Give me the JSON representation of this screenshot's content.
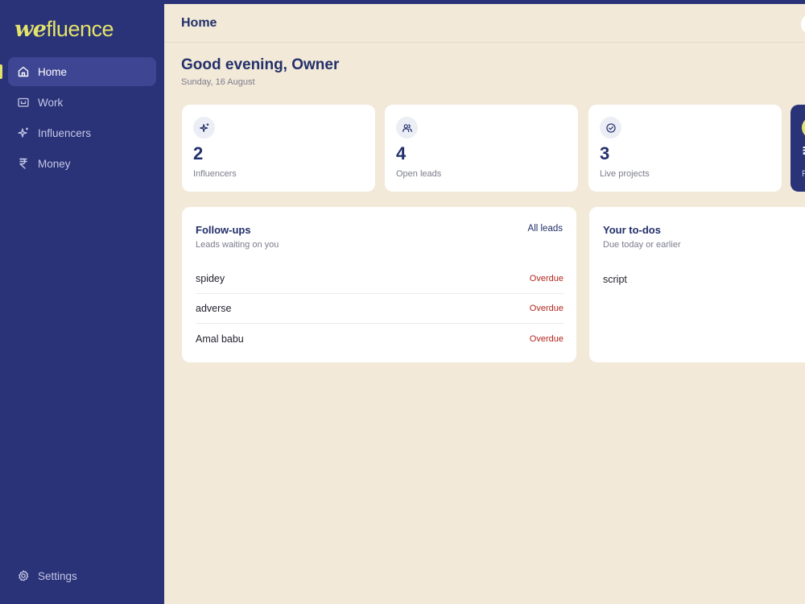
{
  "app": {
    "logo_we": "we",
    "logo_rest": "fluence"
  },
  "sidebar": {
    "items": [
      {
        "label": "Home",
        "icon": "home-icon"
      },
      {
        "label": "Work",
        "icon": "folder-icon"
      },
      {
        "label": "Influencers",
        "icon": "sparkles-icon"
      },
      {
        "label": "Money",
        "icon": "rupee-icon"
      }
    ],
    "settings_label": "Settings"
  },
  "header": {
    "title": "Home"
  },
  "greeting": {
    "title": "Good evening, Owner",
    "date": "Sunday, 16 August"
  },
  "stats": [
    {
      "value": "2",
      "label": "Influencers",
      "icon": "sparkles-icon"
    },
    {
      "value": "4",
      "label": "Open leads",
      "icon": "users-icon"
    },
    {
      "value": "3",
      "label": "Live projects",
      "icon": "check-circle-icon"
    },
    {
      "value": "₹",
      "label": "P",
      "icon": "coin-icon"
    }
  ],
  "followups": {
    "title": "Follow-ups",
    "subtitle": "Leads waiting on you",
    "link": "All leads",
    "rows": [
      {
        "name": "spidey",
        "status": "Overdue"
      },
      {
        "name": "adverse",
        "status": "Overdue"
      },
      {
        "name": "Amal babu",
        "status": "Overdue"
      }
    ]
  },
  "todos": {
    "title": "Your to-dos",
    "subtitle": "Due today or earlier",
    "rows": [
      {
        "name": "script"
      }
    ]
  },
  "colors": {
    "sidebar": "#2a3278",
    "accent": "#e3e36a",
    "background": "#f2e9d8",
    "overdue": "#b3261e"
  }
}
